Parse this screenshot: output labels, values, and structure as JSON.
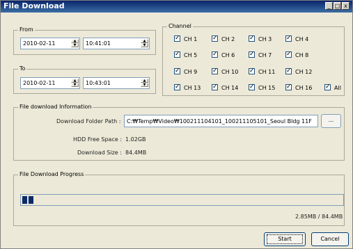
{
  "window": {
    "title": "File Download",
    "minimize": "_",
    "maximize": "□",
    "close": "x"
  },
  "from": {
    "label": "From",
    "date": "2010-02-11",
    "time": "10:41:01"
  },
  "to": {
    "label": "To",
    "date": "2010-02-11",
    "time": "10:43:01"
  },
  "channel": {
    "label": "Channel",
    "items": [
      "CH 1",
      "CH 2",
      "CH 3",
      "CH 4",
      "CH 5",
      "CH 6",
      "CH 7",
      "CH 8",
      "CH 9",
      "CH 10",
      "CH 11",
      "CH 12",
      "CH 13",
      "CH 14",
      "CH 15",
      "CH 16"
    ],
    "all_label": "All",
    "check_glyph": "✓"
  },
  "info": {
    "label": "File download Information",
    "folder_label": "Download Folder Path :",
    "folder_value": "C:₩Temp₩Video₩100211104101_100211105101_Seoul Bldg 11F",
    "browse_label": "...",
    "free_label": "HDD Free Space :",
    "free_value": "1.02GB",
    "size_label": "Download Size :",
    "size_value": "84.4MB"
  },
  "progress": {
    "label": "File Download Progress",
    "text": "2.85MB / 84.4MB",
    "fraction": 0.034
  },
  "buttons": {
    "start": "Start",
    "cancel": "Cancel"
  }
}
